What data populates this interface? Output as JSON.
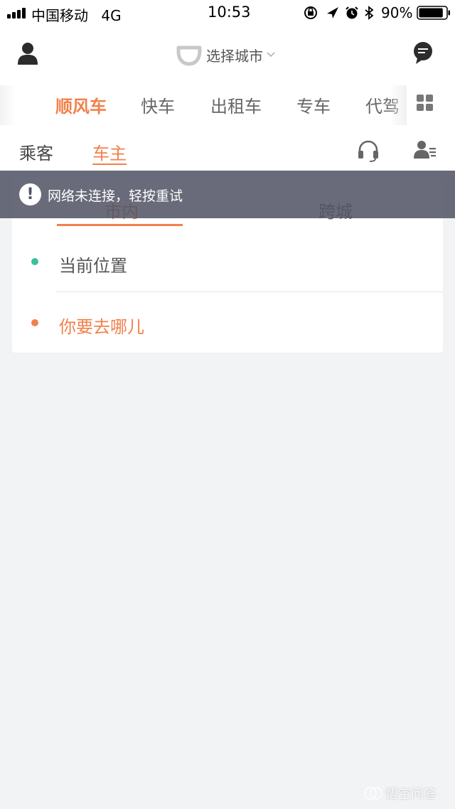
{
  "status_bar": {
    "carrier": "中国移动",
    "network": "4G",
    "time": "10:53",
    "battery_percent": "90%",
    "battery_level": 0.9,
    "icons": [
      "signal-icon",
      "orientation-lock-icon",
      "location-arrow-icon",
      "alarm-icon",
      "bluetooth-icon",
      "battery-icon"
    ]
  },
  "header": {
    "city_select_label": "选择城市",
    "icons": [
      "user-icon",
      "didi-logo-icon",
      "chevron-down-icon",
      "message-icon"
    ]
  },
  "service_tabs": {
    "items": [
      {
        "label": "顺风车",
        "active": true
      },
      {
        "label": "快车",
        "active": false
      },
      {
        "label": "出租车",
        "active": false
      },
      {
        "label": "专车",
        "active": false
      },
      {
        "label": "代驾",
        "active": false
      }
    ],
    "more_icon": "grid-icon"
  },
  "role_tabs": {
    "items": [
      {
        "label": "乘客",
        "active": false
      },
      {
        "label": "车主",
        "active": true
      }
    ],
    "icons": [
      "headset-icon",
      "driver-profile-icon"
    ]
  },
  "trip_card": {
    "tabs": [
      {
        "label": "市内",
        "active": true
      },
      {
        "label": "跨城",
        "active": false
      }
    ],
    "origin_label": "当前位置",
    "destination_label": "你要去哪儿"
  },
  "network_banner": {
    "message": "网络未连接，轻按重试",
    "icon": "exclamation-icon"
  },
  "watermark": {
    "text": "悟空问答"
  },
  "colors": {
    "accent": "#f2804b",
    "origin_dot": "#3dbf9f",
    "destination_dot": "#f2804b",
    "banner_bg": "#505364",
    "page_bg": "#f2f3f5"
  }
}
